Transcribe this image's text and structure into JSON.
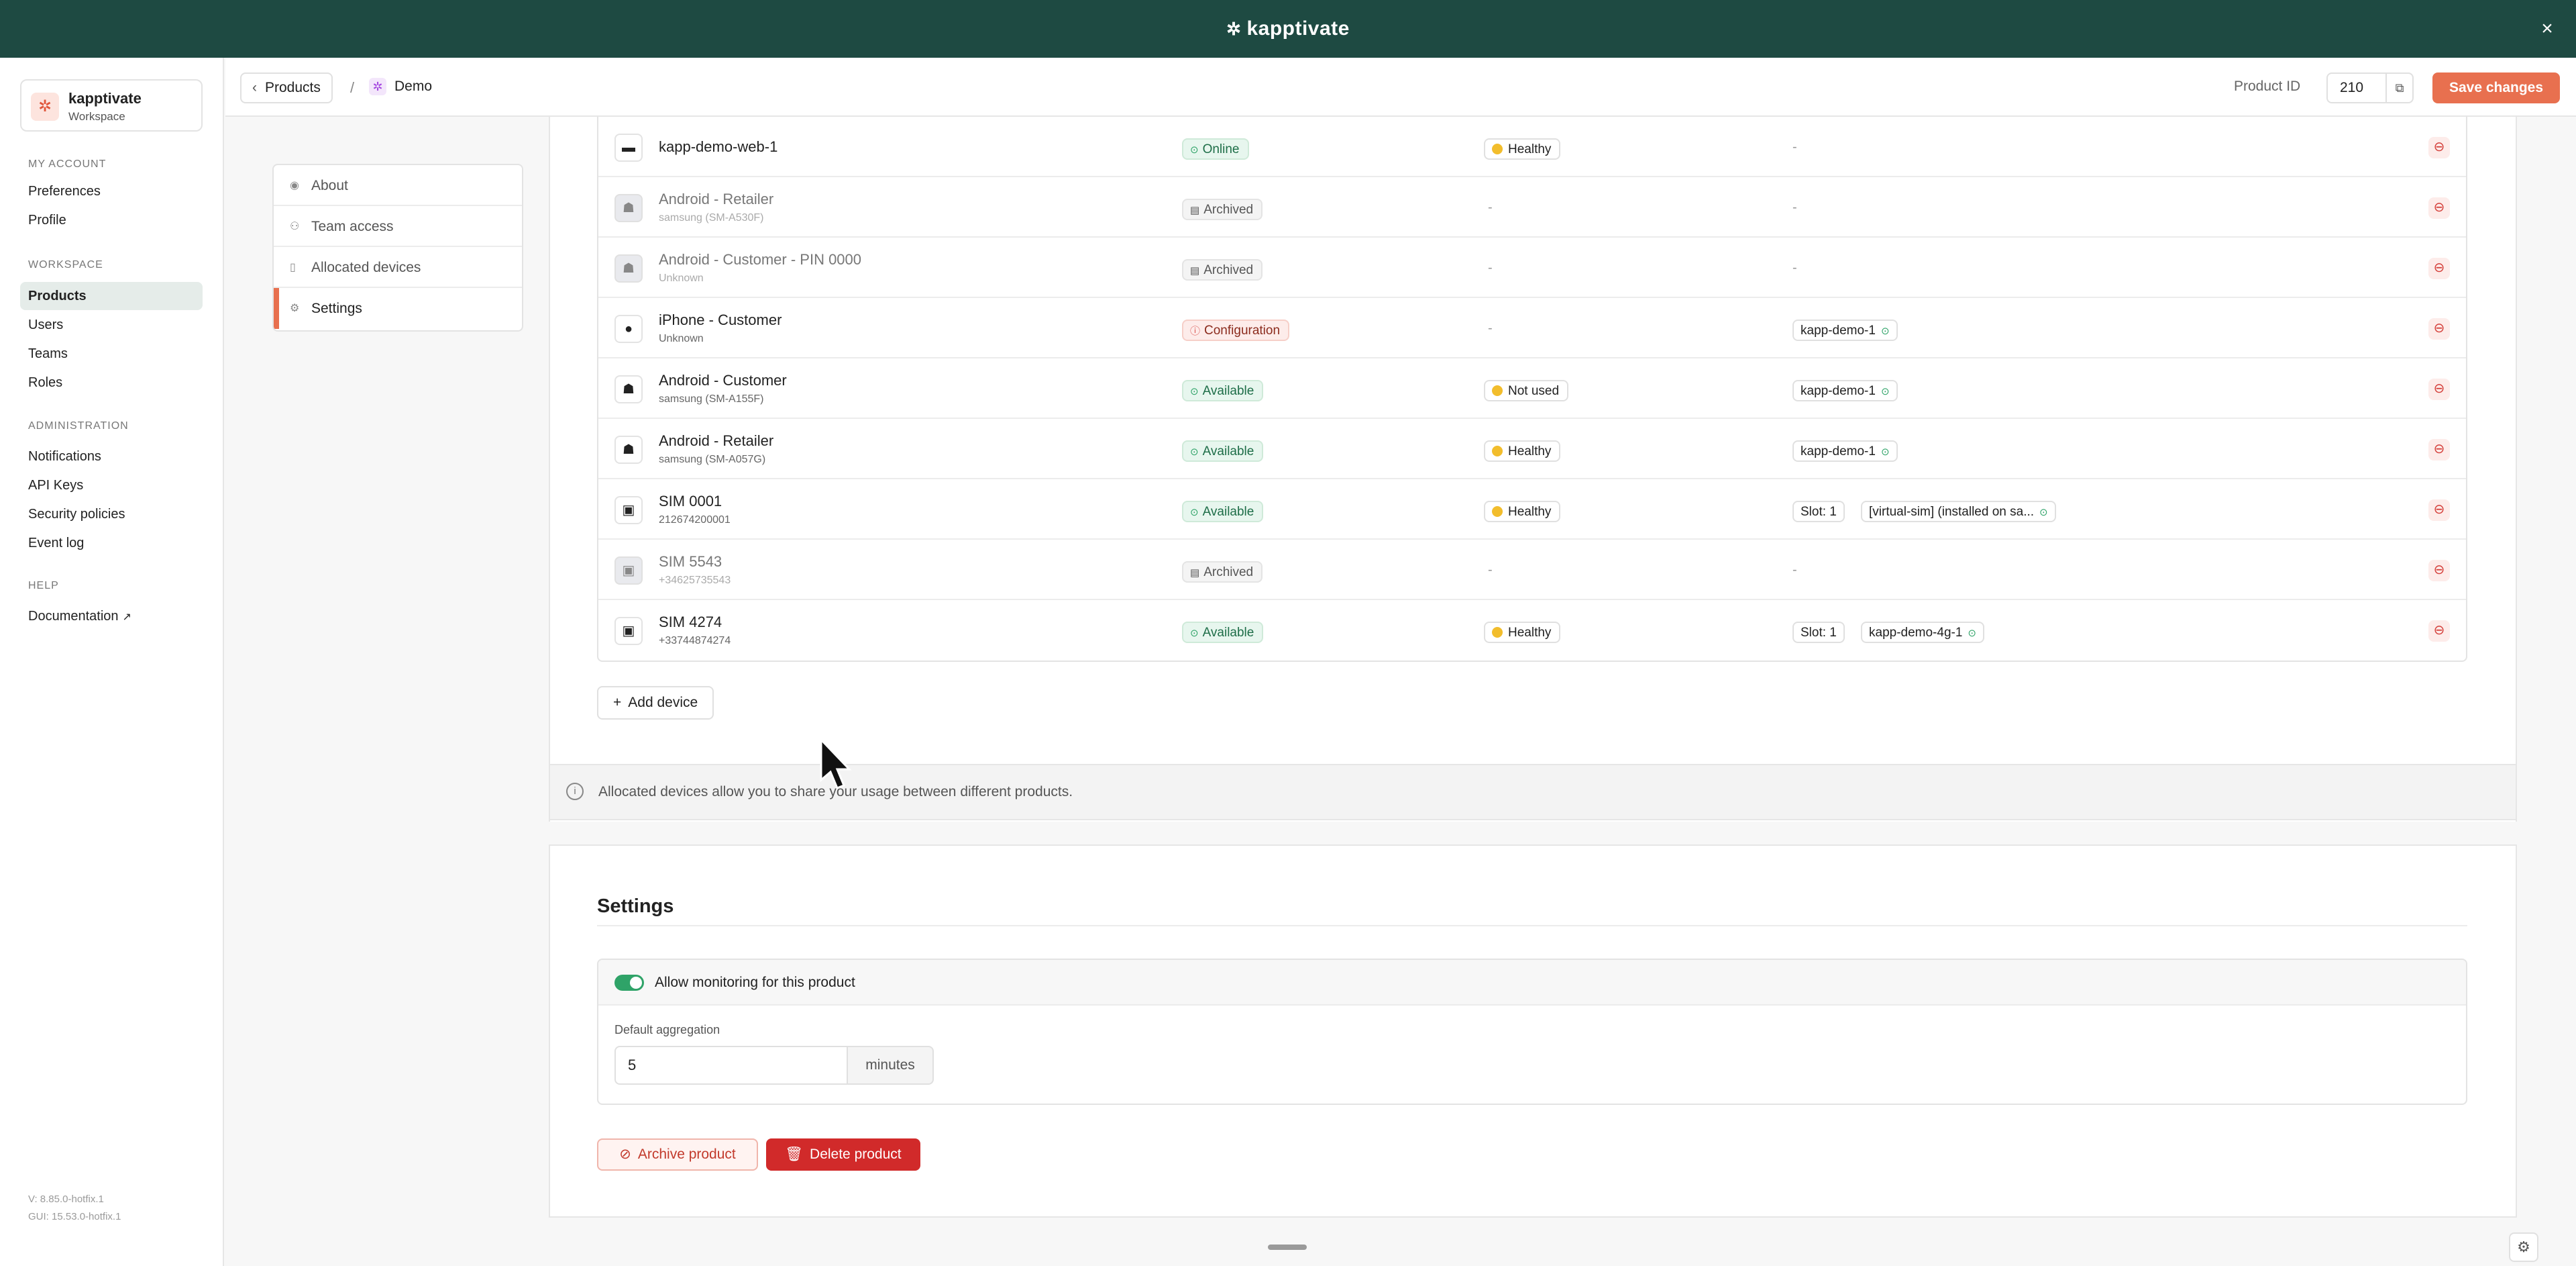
{
  "topbar": {
    "brand": "kapptivate",
    "close": "×"
  },
  "workspace": {
    "name": "kapptivate",
    "type": "Workspace"
  },
  "sidebar": {
    "my_account": "MY ACCOUNT",
    "preferences": "Preferences",
    "profile": "Profile",
    "workspace": "WORKSPACE",
    "products": "Products",
    "users": "Users",
    "teams": "Teams",
    "roles": "Roles",
    "administration": "ADMINISTRATION",
    "notifications": "Notifications",
    "api_keys": "API Keys",
    "security_policies": "Security policies",
    "event_log": "Event log",
    "help": "HELP",
    "documentation": "Documentation",
    "version": "V: 8.85.0-hotfix.1",
    "gui_version": "GUI: 15.53.0-hotfix.1"
  },
  "header": {
    "back_label": "Products",
    "separator": "/",
    "current": "Demo",
    "product_id_label": "Product ID",
    "product_id": "210",
    "save": "Save changes"
  },
  "tabs": [
    {
      "label": "About",
      "icon": "eye-icon"
    },
    {
      "label": "Team access",
      "icon": "users-icon"
    },
    {
      "label": "Allocated devices",
      "icon": "phone-icon"
    },
    {
      "label": "Settings",
      "icon": "gear-icon"
    }
  ],
  "devices": [
    {
      "name": "kapp-demo-web-1",
      "sub": "",
      "icon": "browser-icon",
      "status": "Online",
      "health": "Healthy",
      "alloc": "-"
    },
    {
      "name": "Android - Retailer",
      "sub": "samsung (SM-A530F)",
      "icon": "android-icon",
      "status": "Archived",
      "health": "-",
      "alloc": "-"
    },
    {
      "name": "Android - Customer - PIN 0000",
      "sub": "Unknown",
      "icon": "android-icon",
      "status": "Archived",
      "health": "-",
      "alloc": "-"
    },
    {
      "name": "iPhone - Customer",
      "sub": "Unknown",
      "icon": "apple-icon",
      "status": "Configuration",
      "health": "-",
      "alloc": "kapp-demo-1"
    },
    {
      "name": "Android - Customer",
      "sub": "samsung (SM-A155F)",
      "icon": "android-icon",
      "status": "Available",
      "health": "Not used",
      "alloc": "kapp-demo-1"
    },
    {
      "name": "Android - Retailer",
      "sub": "samsung (SM-A057G)",
      "icon": "android-icon",
      "status": "Available",
      "health": "Healthy",
      "alloc": "kapp-demo-1"
    },
    {
      "name": "SIM 0001",
      "sub": "212674200001",
      "icon": "sim-icon",
      "status": "Available",
      "health": "Healthy",
      "slot": "Slot: 1",
      "alloc": "[virtual-sim] (installed on sa..."
    },
    {
      "name": "SIM 5543",
      "sub": "+34625735543",
      "icon": "sim-icon",
      "status": "Archived",
      "health": "-",
      "alloc": "-"
    },
    {
      "name": "SIM 4274",
      "sub": "+33744874274",
      "icon": "sim-icon",
      "status": "Available",
      "health": "Healthy",
      "slot": "Slot: 1",
      "alloc": "kapp-demo-4g-1"
    }
  ],
  "add_device": "Add device",
  "info": "Allocated devices allow you to share your usage between different products.",
  "settings": {
    "title": "Settings",
    "monitoring_label": "Allow monitoring for this product",
    "monitoring_enabled": true,
    "aggregation_label": "Default aggregation",
    "aggregation_value": "5",
    "aggregation_unit": "minutes",
    "archive": "Archive product",
    "delete": "Delete product"
  },
  "colors": {
    "topbar": "#1e4a42",
    "accent": "#e8704f",
    "danger": "#d12a2a",
    "success": "#2fa368"
  }
}
